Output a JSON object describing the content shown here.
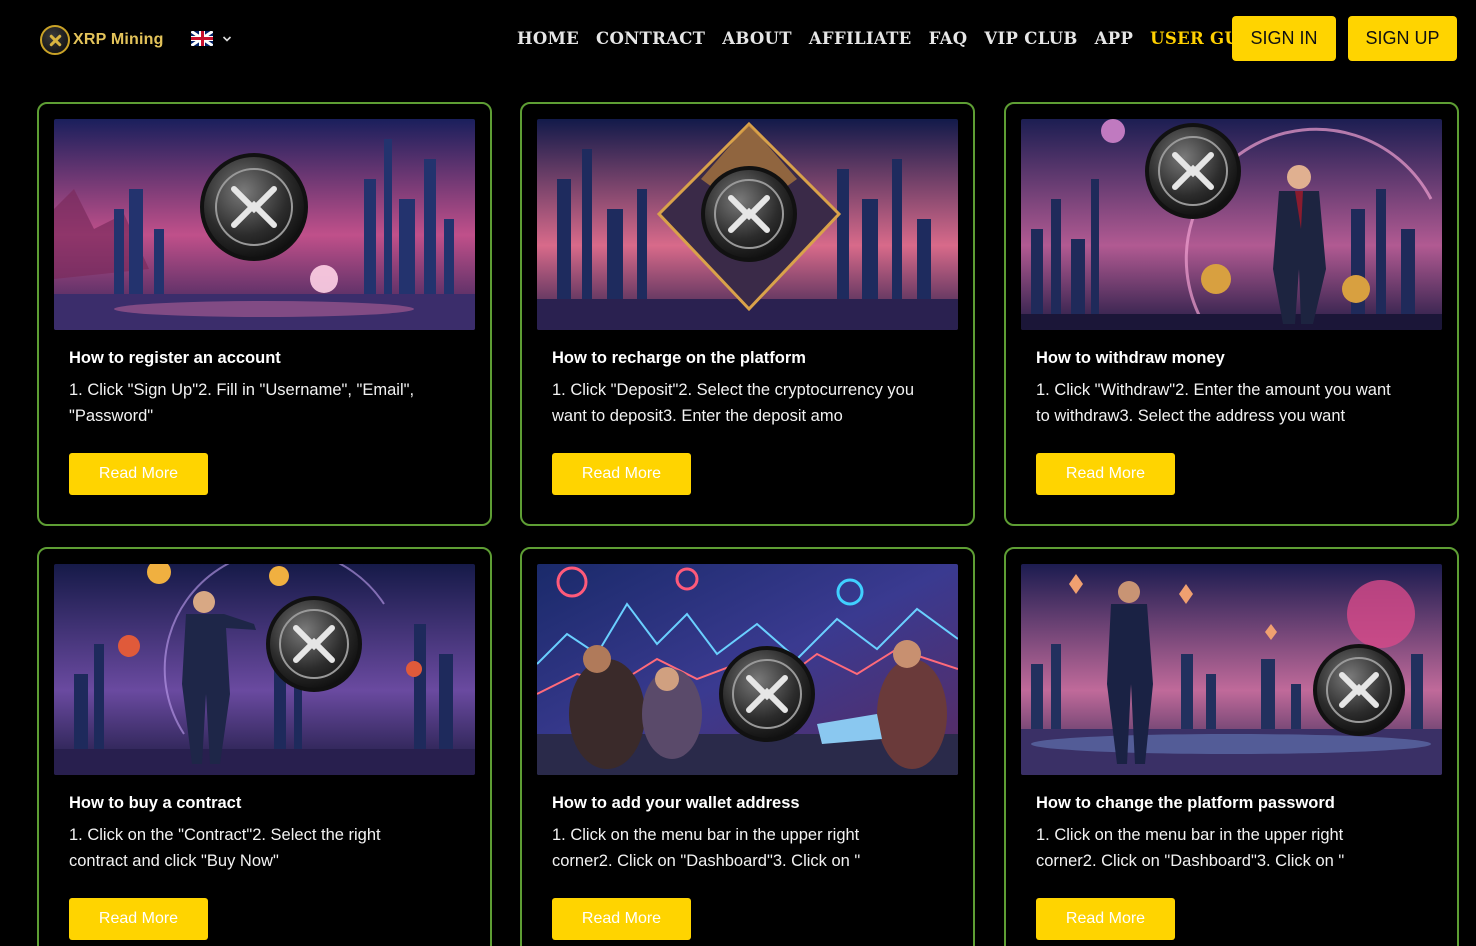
{
  "header": {
    "logo_text": "XRP Mining",
    "language": "English",
    "nav": [
      {
        "label": "HOME"
      },
      {
        "label": "CONTRACT"
      },
      {
        "label": "ABOUT"
      },
      {
        "label": "AFFILIATE"
      },
      {
        "label": "FAQ"
      },
      {
        "label": "VIP CLUB"
      },
      {
        "label": "APP"
      },
      {
        "label": "USER GUIDE",
        "active": true
      }
    ],
    "sign_in": "SIGN IN",
    "sign_up": "SIGN UP"
  },
  "colors": {
    "accent": "#ffd400",
    "card_border": "#5e9e34",
    "background": "#000000"
  },
  "guides": [
    {
      "title": "How to register an account",
      "description": "1. Click \"Sign Up\"2. Fill in \"Username\", \"Email\", \"Password\"",
      "button": "Read More",
      "image": "xrp-coin-city-sunset-image"
    },
    {
      "title": "How to recharge on the platform",
      "description": "1. Click \"Deposit\"2. Select the cryptocurrency you want to deposit3. Enter the deposit amo",
      "button": "Read More",
      "image": "xrp-coin-diamond-city-image"
    },
    {
      "title": "How to withdraw money",
      "description": "1. Click \"Withdraw\"2. Enter the amount you want to withdraw3. Select the address you want",
      "button": "Read More",
      "image": "businessman-xrp-coin-image"
    },
    {
      "title": "How to buy a contract",
      "description": "1. Click on the  \"Contract\"2. Select the right contract and click \"Buy Now\"",
      "button": "Read More",
      "image": "man-pointing-xrp-coin-image"
    },
    {
      "title": "How to add your wallet address",
      "description": "1. Click on the menu bar in the upper right corner2. Click on \"Dashboard\"3. Click on \"",
      "button": "Read More",
      "image": "people-laptops-xrp-coin-image"
    },
    {
      "title": "How to change the platform password",
      "description": "1. Click on the menu bar in the upper right corner2. Click on \"Dashboard\"3. Click on \"",
      "button": "Read More",
      "image": "man-standing-xrp-coin-image"
    }
  ]
}
